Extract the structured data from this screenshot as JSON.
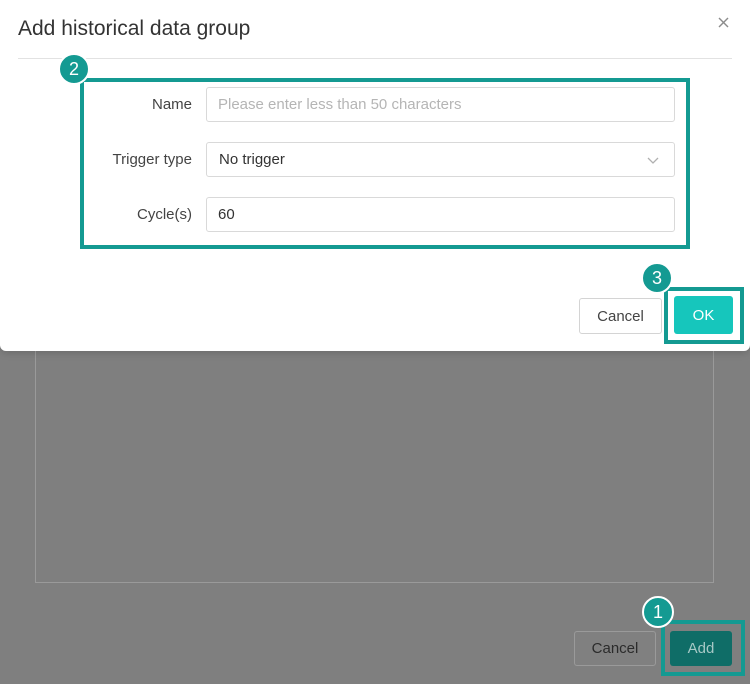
{
  "background": {
    "cancel_label": "Cancel",
    "add_label": "Add"
  },
  "modal": {
    "title": "Add historical data group",
    "fields": {
      "name": {
        "label": "Name",
        "value": "",
        "placeholder": "Please enter less than 50 characters"
      },
      "trigger_type": {
        "label": "Trigger type",
        "selected": "No trigger"
      },
      "cycle": {
        "label": "Cycle(s)",
        "value": "60"
      }
    },
    "cancel_label": "Cancel",
    "ok_label": "OK"
  },
  "annotations": {
    "step1": "1",
    "step2": "2",
    "step3": "3"
  },
  "colors": {
    "accent": "#16c6bc",
    "annotation": "#149a92",
    "overlay": "#7f7f7f"
  },
  "icons": {
    "close": "close-icon",
    "dropdown": "chevron-down-icon"
  }
}
